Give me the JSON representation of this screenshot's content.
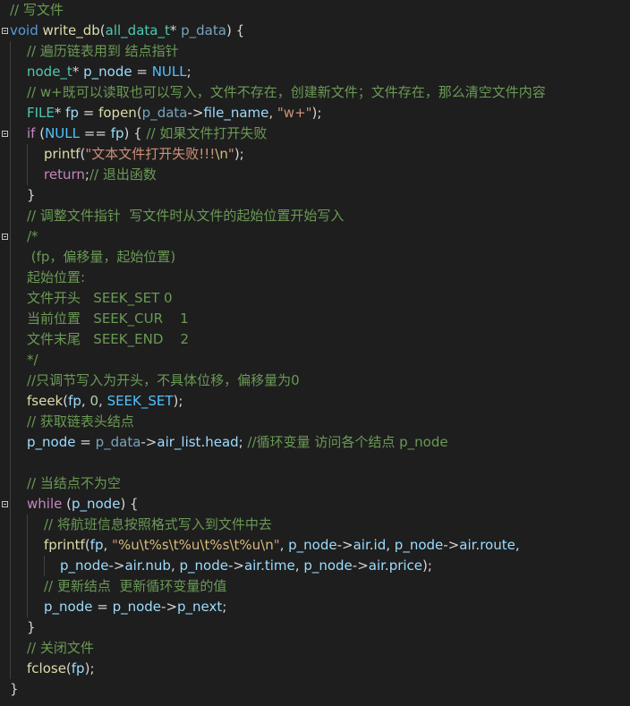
{
  "lines": [
    [
      {
        "t": "// 写文件",
        "c": "g"
      }
    ],
    [
      {
        "t": "void",
        "c": "k"
      },
      {
        "t": " ",
        "c": "o"
      },
      {
        "t": "write_db",
        "c": "f"
      },
      {
        "t": "(",
        "c": "o"
      },
      {
        "t": "all_data_t",
        "c": "t"
      },
      {
        "t": "* ",
        "c": "o"
      },
      {
        "t": "p_data",
        "c": "p"
      },
      {
        "t": ") {",
        "c": "o"
      }
    ],
    [
      {
        "t": "// 遍历链表用到 结点指针",
        "c": "g"
      }
    ],
    [
      {
        "t": "node_t",
        "c": "t"
      },
      {
        "t": "* ",
        "c": "o"
      },
      {
        "t": "p_node",
        "c": "v"
      },
      {
        "t": " = ",
        "c": "o"
      },
      {
        "t": "NULL",
        "c": "m"
      },
      {
        "t": ";",
        "c": "o"
      }
    ],
    [
      {
        "t": "// w+既可以读取也可以写入，文件不存在，创建新文件；文件存在，那么清空文件内容",
        "c": "g"
      }
    ],
    [
      {
        "t": "FILE",
        "c": "t"
      },
      {
        "t": "* ",
        "c": "o"
      },
      {
        "t": "fp",
        "c": "v"
      },
      {
        "t": " = ",
        "c": "o"
      },
      {
        "t": "fopen",
        "c": "f"
      },
      {
        "t": "(",
        "c": "o"
      },
      {
        "t": "p_data",
        "c": "p"
      },
      {
        "t": "->",
        "c": "o"
      },
      {
        "t": "file_name",
        "c": "v"
      },
      {
        "t": ", ",
        "c": "o"
      },
      {
        "t": "\"w+\"",
        "c": "s"
      },
      {
        "t": ");",
        "c": "o"
      }
    ],
    [
      {
        "t": "if",
        "c": "c"
      },
      {
        "t": " (",
        "c": "o"
      },
      {
        "t": "NULL",
        "c": "m"
      },
      {
        "t": " == ",
        "c": "o"
      },
      {
        "t": "fp",
        "c": "v"
      },
      {
        "t": ") { ",
        "c": "o"
      },
      {
        "t": "// 如果文件打开失败",
        "c": "g"
      }
    ],
    [
      {
        "t": "printf",
        "c": "f"
      },
      {
        "t": "(",
        "c": "o"
      },
      {
        "t": "\"文本文件打开失败!!!",
        "c": "s"
      },
      {
        "t": "\\n",
        "c": "e"
      },
      {
        "t": "\"",
        "c": "s"
      },
      {
        "t": ");",
        "c": "o"
      }
    ],
    [
      {
        "t": "return",
        "c": "c"
      },
      {
        "t": ";",
        "c": "o"
      },
      {
        "t": "// 退出函数",
        "c": "g"
      }
    ],
    [
      {
        "t": "}",
        "c": "o"
      }
    ],
    [
      {
        "t": "// 调整文件指针  写文件时从文件的起始位置开始写入",
        "c": "g"
      }
    ],
    [
      {
        "t": "/*",
        "c": "g"
      }
    ],
    [
      {
        "t": " (fp，偏移量，起始位置)",
        "c": "g"
      }
    ],
    [
      {
        "t": "起始位置:",
        "c": "g"
      }
    ],
    [
      {
        "t": "文件开头   SEEK_SET 0",
        "c": "g"
      }
    ],
    [
      {
        "t": "当前位置   SEEK_CUR    1",
        "c": "g"
      }
    ],
    [
      {
        "t": "文件末尾   SEEK_END    2",
        "c": "g"
      }
    ],
    [
      {
        "t": "*/",
        "c": "g"
      }
    ],
    [
      {
        "t": "//只调节写入为开头，不具体位移，偏移量为0",
        "c": "g"
      }
    ],
    [
      {
        "t": "fseek",
        "c": "f"
      },
      {
        "t": "(",
        "c": "o"
      },
      {
        "t": "fp",
        "c": "v"
      },
      {
        "t": ", ",
        "c": "o"
      },
      {
        "t": "0",
        "c": "n"
      },
      {
        "t": ", ",
        "c": "o"
      },
      {
        "t": "SEEK_SET",
        "c": "m"
      },
      {
        "t": ");",
        "c": "o"
      }
    ],
    [
      {
        "t": "// 获取链表头结点",
        "c": "g"
      }
    ],
    [
      {
        "t": "p_node",
        "c": "v"
      },
      {
        "t": " = ",
        "c": "o"
      },
      {
        "t": "p_data",
        "c": "p"
      },
      {
        "t": "->",
        "c": "o"
      },
      {
        "t": "air_list",
        "c": "v"
      },
      {
        "t": ".",
        "c": "o"
      },
      {
        "t": "head",
        "c": "v"
      },
      {
        "t": "; ",
        "c": "o"
      },
      {
        "t": "//循环变量 访问各个结点 p_node",
        "c": "g"
      }
    ],
    [],
    [
      {
        "t": "// 当结点不为空",
        "c": "g"
      }
    ],
    [
      {
        "t": "while",
        "c": "c"
      },
      {
        "t": " (",
        "c": "o"
      },
      {
        "t": "p_node",
        "c": "v"
      },
      {
        "t": ") {",
        "c": "o"
      }
    ],
    [
      {
        "t": "// 将航班信息按照格式写入到文件中去",
        "c": "g"
      }
    ],
    [
      {
        "t": "fprintf",
        "c": "f"
      },
      {
        "t": "(",
        "c": "o"
      },
      {
        "t": "fp",
        "c": "v"
      },
      {
        "t": ", ",
        "c": "o"
      },
      {
        "t": "\"",
        "c": "s"
      },
      {
        "t": "%u",
        "c": "e"
      },
      {
        "t": "\\t",
        "c": "e"
      },
      {
        "t": "%s",
        "c": "e"
      },
      {
        "t": "\\t",
        "c": "e"
      },
      {
        "t": "%u",
        "c": "e"
      },
      {
        "t": "\\t",
        "c": "e"
      },
      {
        "t": "%s",
        "c": "e"
      },
      {
        "t": "\\t",
        "c": "e"
      },
      {
        "t": "%u",
        "c": "e"
      },
      {
        "t": "\\n",
        "c": "e"
      },
      {
        "t": "\"",
        "c": "s"
      },
      {
        "t": ", ",
        "c": "o"
      },
      {
        "t": "p_node",
        "c": "v"
      },
      {
        "t": "->",
        "c": "o"
      },
      {
        "t": "air",
        "c": "v"
      },
      {
        "t": ".",
        "c": "o"
      },
      {
        "t": "id",
        "c": "v"
      },
      {
        "t": ", ",
        "c": "o"
      },
      {
        "t": "p_node",
        "c": "v"
      },
      {
        "t": "->",
        "c": "o"
      },
      {
        "t": "air",
        "c": "v"
      },
      {
        "t": ".",
        "c": "o"
      },
      {
        "t": "route",
        "c": "v"
      },
      {
        "t": ",",
        "c": "o"
      }
    ],
    [
      {
        "t": "p_node",
        "c": "v"
      },
      {
        "t": "->",
        "c": "o"
      },
      {
        "t": "air",
        "c": "v"
      },
      {
        "t": ".",
        "c": "o"
      },
      {
        "t": "nub",
        "c": "v"
      },
      {
        "t": ", ",
        "c": "o"
      },
      {
        "t": "p_node",
        "c": "v"
      },
      {
        "t": "->",
        "c": "o"
      },
      {
        "t": "air",
        "c": "v"
      },
      {
        "t": ".",
        "c": "o"
      },
      {
        "t": "time",
        "c": "v"
      },
      {
        "t": ", ",
        "c": "o"
      },
      {
        "t": "p_node",
        "c": "v"
      },
      {
        "t": "->",
        "c": "o"
      },
      {
        "t": "air",
        "c": "v"
      },
      {
        "t": ".",
        "c": "o"
      },
      {
        "t": "price",
        "c": "v"
      },
      {
        "t": ");",
        "c": "o"
      }
    ],
    [
      {
        "t": "// 更新结点  更新循环变量的值",
        "c": "g"
      }
    ],
    [
      {
        "t": "p_node",
        "c": "v"
      },
      {
        "t": " = ",
        "c": "o"
      },
      {
        "t": "p_node",
        "c": "v"
      },
      {
        "t": "->",
        "c": "o"
      },
      {
        "t": "p_next",
        "c": "v"
      },
      {
        "t": ";",
        "c": "o"
      }
    ],
    [
      {
        "t": "}",
        "c": "o"
      }
    ],
    [
      {
        "t": "// 关闭文件",
        "c": "g"
      }
    ],
    [
      {
        "t": "fclose",
        "c": "f"
      },
      {
        "t": "(",
        "c": "o"
      },
      {
        "t": "fp",
        "c": "v"
      },
      {
        "t": ");",
        "c": "o"
      }
    ],
    [
      {
        "t": "}",
        "c": "o"
      }
    ]
  ]
}
